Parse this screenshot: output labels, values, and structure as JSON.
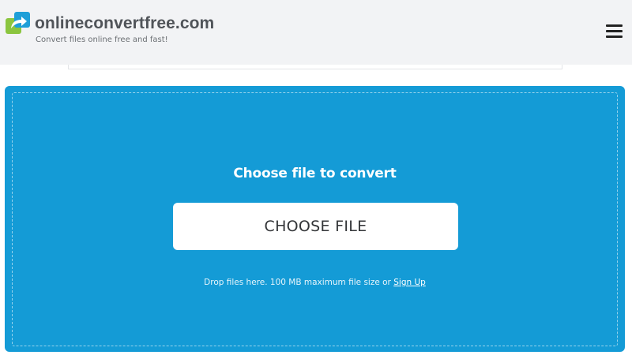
{
  "header": {
    "brand_name": "onlineconvertfree.com",
    "tagline": "Convert files online free and fast!",
    "logo_icon": "arrow-convert-logo-icon",
    "menu_icon": "hamburger-menu-icon"
  },
  "upload": {
    "title": "Choose file to convert",
    "choose_button_label": "CHOOSE FILE",
    "hint_prefix": "Drop files here. 100 MB maximum file size or",
    "signup_link": "Sign Up"
  },
  "colors": {
    "header_bg": "#f2f3f5",
    "dropzone_bg": "#149bd6",
    "logo_green": "#8bc53f",
    "logo_blue": "#1e9fd8"
  }
}
